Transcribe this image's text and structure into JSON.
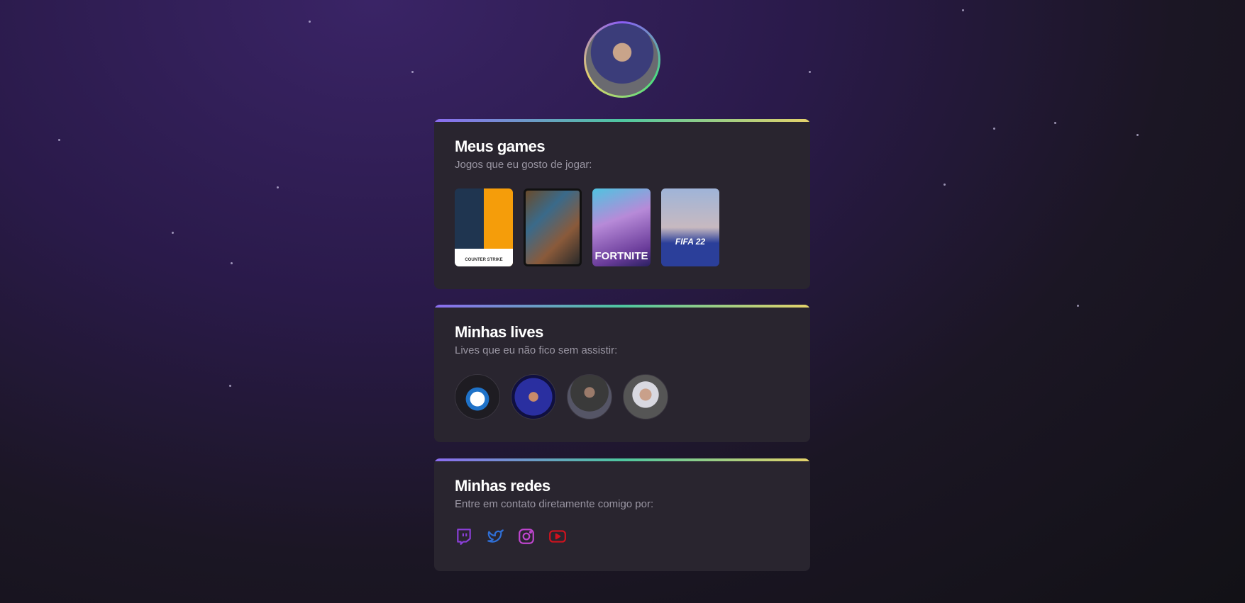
{
  "profile": {
    "avatar_alt": "profile photo"
  },
  "games_card": {
    "title": "Meus games",
    "subtitle": "Jogos que eu gosto de jogar:",
    "games": [
      {
        "name": "Counter Strike",
        "label": "COUNTER STRIKE"
      },
      {
        "name": "Grand Theft Auto V"
      },
      {
        "name": "Fortnite",
        "label": "FORTNITE"
      },
      {
        "name": "FIFA 22",
        "label": "FIFA 22"
      }
    ]
  },
  "lives_card": {
    "title": "Minhas lives",
    "subtitle": "Lives que eu não fico sem assistir:"
  },
  "social_card": {
    "title": "Minhas redes",
    "subtitle": "Entre em contato diretamente comigo por:",
    "links": [
      {
        "icon": "twitch-icon",
        "color": "#8b3fd9"
      },
      {
        "icon": "twitter-icon",
        "color": "#2f6fd6"
      },
      {
        "icon": "instagram-icon",
        "color": "#c045d0"
      },
      {
        "icon": "youtube-icon",
        "color": "#d0121e"
      }
    ]
  }
}
